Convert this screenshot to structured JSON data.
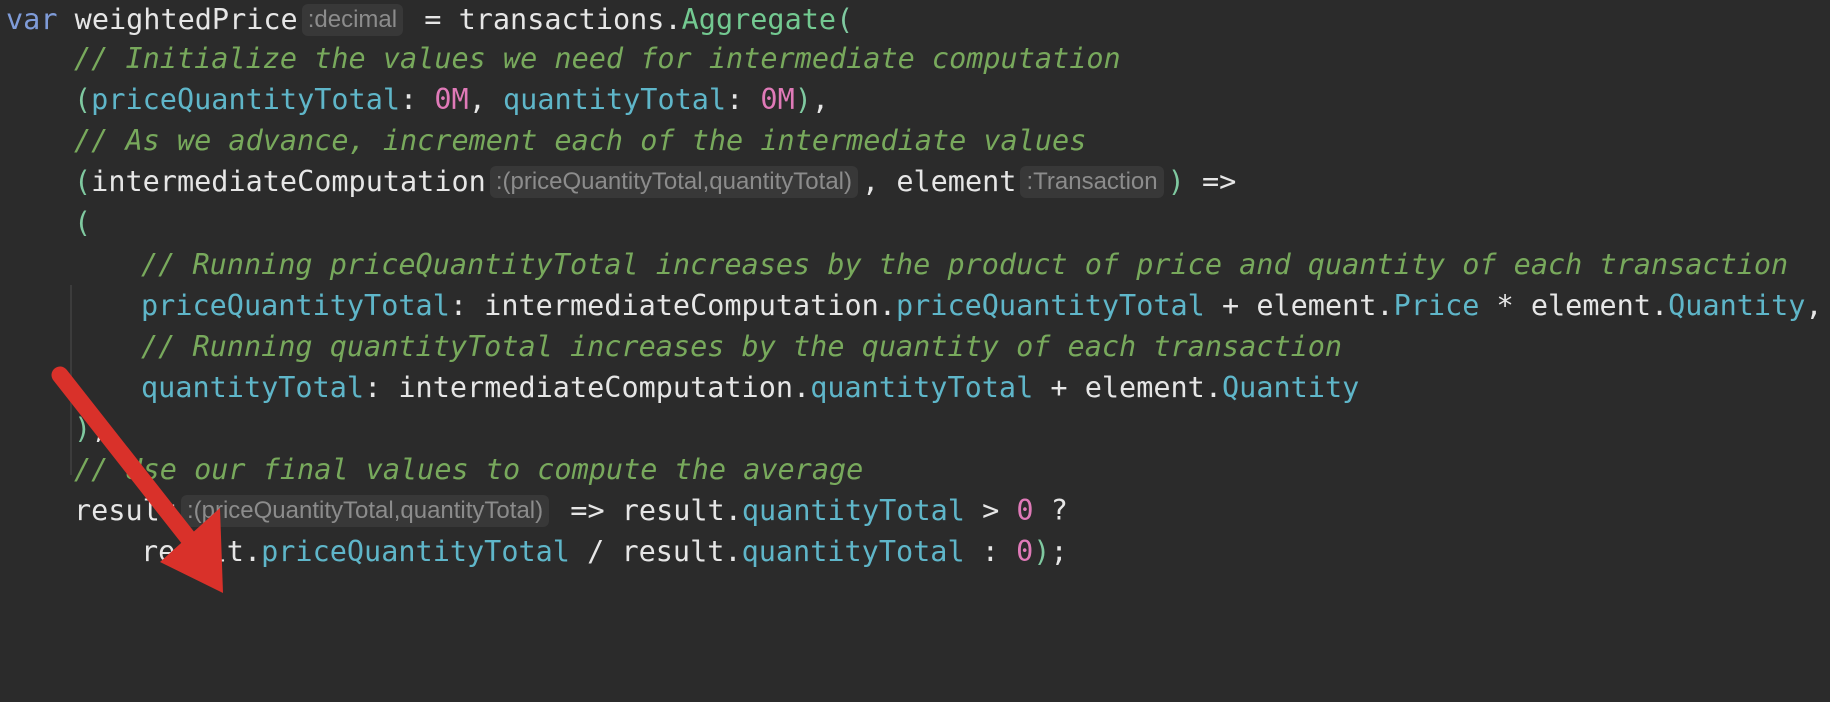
{
  "code": {
    "l1": {
      "kw": "var",
      "name": "weightedPrice",
      "hint": ":decimal",
      "assign": " = transactions.",
      "method": "Aggregate",
      "open": "("
    },
    "l2": {
      "comment": "// Initialize the values we need for intermediate computation"
    },
    "l3": {
      "open": "(",
      "p1": "priceQuantityTotal",
      "c1": ": ",
      "v1": "0M",
      "sep": ", ",
      "p2": "quantityTotal",
      "c2": ": ",
      "v2": "0M",
      "close": ")",
      "tail": ","
    },
    "l4": {
      "comment": "// As we advance, increment each of the intermediate values"
    },
    "l5": {
      "open": "(",
      "arg1": "intermediateComputation",
      "hint1": ":(priceQuantityTotal,quantityTotal)",
      "sep": ", element",
      "hint2": ":Transaction",
      "close": ")",
      "arrow": " =>"
    },
    "l6": {
      "open": "("
    },
    "l7": {
      "comment": "// Running priceQuantityTotal increases by the product of price and quantity of each transaction"
    },
    "l8": {
      "p1": "priceQuantityTotal",
      "t1": ": intermediateComputation.",
      "p2": "priceQuantityTotal",
      "t2": " + element.",
      "p3": "Price",
      "t3": " * element.",
      "p4": "Quantity",
      "t4": ","
    },
    "l9": {
      "comment": "// Running quantityTotal increases by the quantity of each transaction"
    },
    "l10": {
      "p1": "quantityTotal",
      "t1": ": intermediateComputation.",
      "p2": "quantityTotal",
      "t2": " + element.",
      "p3": "Quantity"
    },
    "l11": {
      "close": ")",
      "tail": ","
    },
    "l12": {
      "comment": "// Use our final values to compute the average"
    },
    "l13": {
      "name": "result",
      "hint": ":(priceQuantityTotal,quantityTotal)",
      "t1": " => result.",
      "p1": "quantityTotal",
      "t2": " > ",
      "v1": "0",
      "t3": " ?"
    },
    "l14": {
      "t1": "result.",
      "p1": "priceQuantityTotal",
      "t2": " / result.",
      "p2": "quantityTotal",
      "t3": " : ",
      "v1": "0",
      "close": ")",
      "tail": ";"
    }
  },
  "annotation": {
    "arrow_color": "#d9312a"
  },
  "colors": {
    "background": "#2b2b2b",
    "comment": "#78a95c",
    "property": "#5fb6c9",
    "number": "#e07ab8",
    "keyword": "#7f9cd9"
  }
}
